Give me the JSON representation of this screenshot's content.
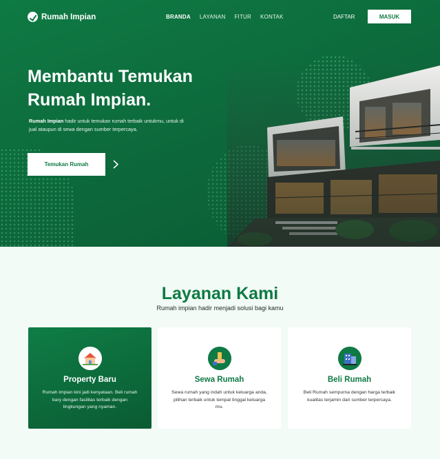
{
  "brand": {
    "name": "Rumah Impian",
    "icon": "leaf-check-icon"
  },
  "nav": {
    "items": [
      {
        "label": "BRANDA",
        "active": true
      },
      {
        "label": "LAYANAN",
        "active": false
      },
      {
        "label": "FITUR",
        "active": false
      },
      {
        "label": "KONTAK",
        "active": false
      }
    ],
    "daftar_label": "DAFTAR",
    "masuk_label": "MASUK"
  },
  "hero": {
    "headline_line1": "Membantu Temukan",
    "headline_line2": "Rumah Impian.",
    "desc_bold": "Rumah Impian",
    "desc_rest": " hadir untuk temukan rumah terbaik untukmu, untuk di jual ataupun di sewa dengan sumber terpercaya.",
    "cta_label": "Temukan Rumah"
  },
  "services": {
    "title": "Layanan Kami",
    "subtitle": "Rumah impian hadir menjadi solusi bagi kamu",
    "cards": [
      {
        "title": "Property Baru",
        "text": "Rumah impian kini jadi kenyataan. Beli rumah bary dengan fasilitas terbaik dengan lingkungan yang nyaman.",
        "icon": "house-icon"
      },
      {
        "title": "Sewa Rumah",
        "text": "Sewa rumah yang indah untuk keluarga anda, pilihan terbaik untuk tempat tinggal keluarga mu.",
        "icon": "hand-key-icon"
      },
      {
        "title": "Beli Rumah",
        "text": "Beli Rumah sempurna dengan harga terbaik kualitas terjamin dari sumber terpercaya.",
        "icon": "building-icon"
      }
    ]
  },
  "colors": {
    "primary": "#0e7a44",
    "dark": "#0a5a33",
    "background": "#f2fbf5"
  }
}
